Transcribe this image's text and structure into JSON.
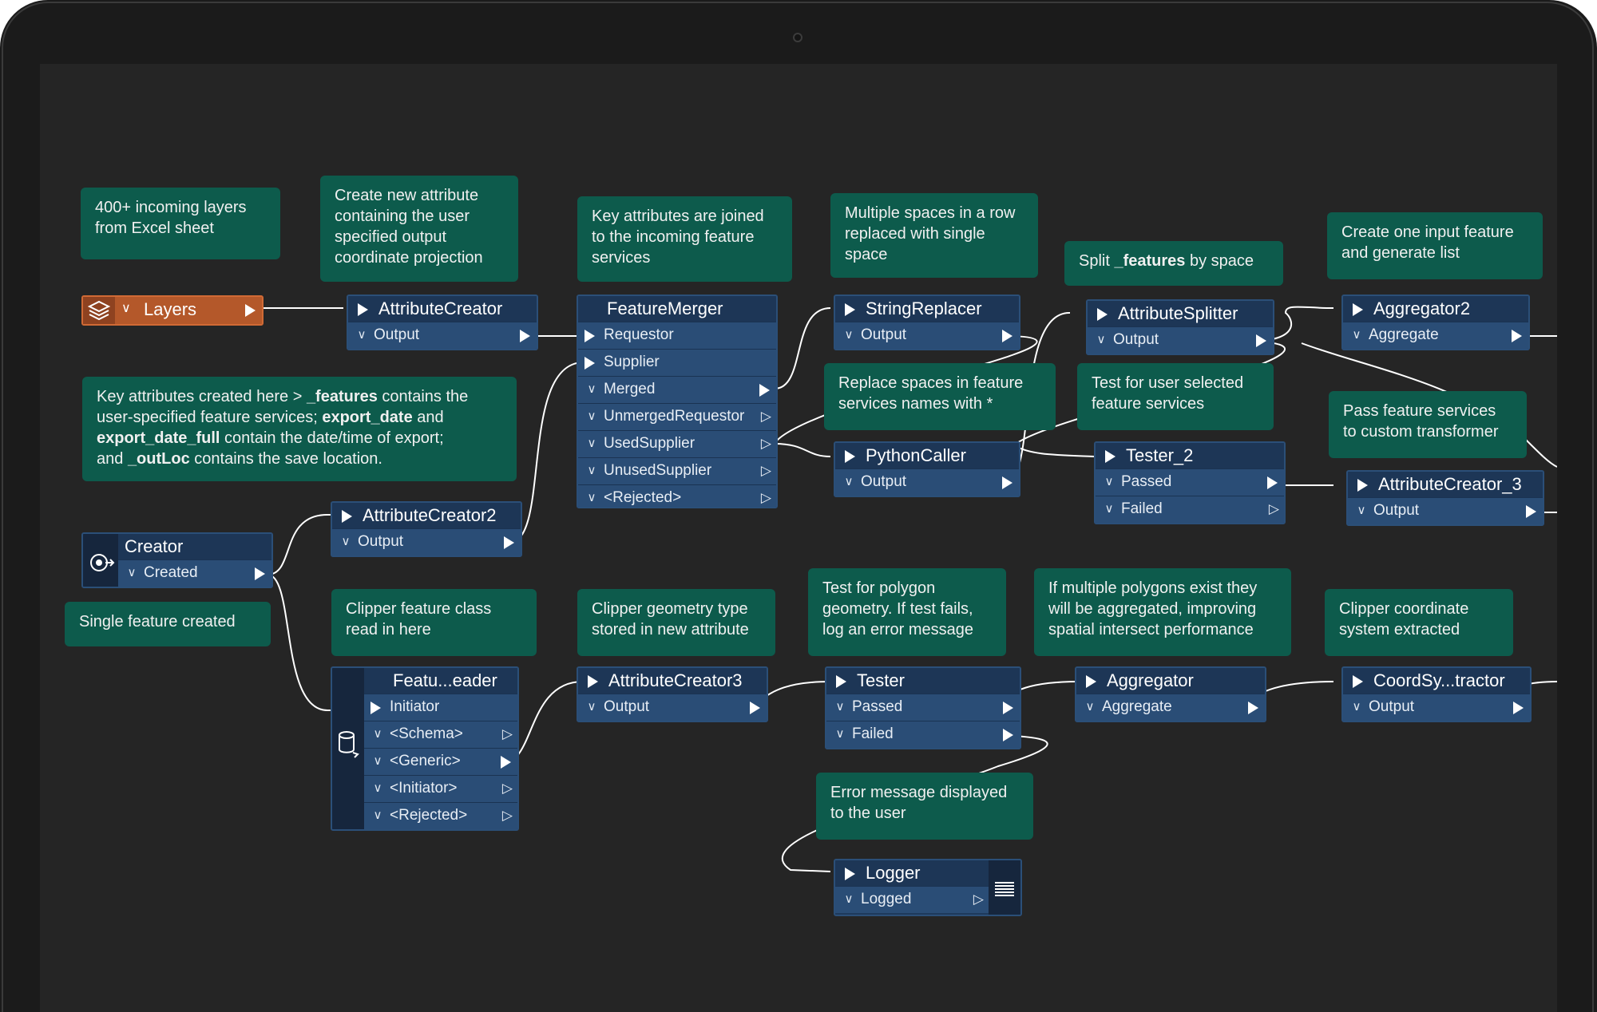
{
  "annotations": {
    "layers": "400+ incoming layers\nfrom Excel sheet",
    "create_attr": "Create new attribute\ncontaining the user\nspecified output\ncoordinate projection",
    "key_joined": "Key attributes are joined\nto the incoming feature\nservices",
    "multi_spaces": "Multiple spaces in a row\nreplaced with single\nspace",
    "split_pre": "Split ",
    "split_bold": "_features",
    "split_post": " by space",
    "create_one": "Create one input feature\nand generate list",
    "key_created_1": "Key attributes created here > ",
    "key_created_b1": "_features",
    "key_created_2": " contains the\nuser-specified feature services; ",
    "key_created_b2": "export_date",
    "key_created_3": " and\n",
    "key_created_b3": "export_date_full",
    "key_created_4": " contain the date/time of export;\nand ",
    "key_created_b4": "_outLoc",
    "key_created_5": " contains the save location.",
    "replace_spaces": "Replace spaces in feature\nservices names with *",
    "test_user": "Test for user selected\nfeature services",
    "pass_feature": "Pass feature services\nto custom transformer",
    "single_feature": "Single feature created",
    "clipper_class": "Clipper feature class\nread in here",
    "clipper_geom": "Clipper geometry type\nstored in new attribute",
    "test_polygon": "Test for polygon\ngeometry. If test fails,\nlog an error message",
    "multi_polygons": "If multiple polygons exist they\nwill be aggregated, improving\nspatial intersect performance",
    "clipper_coord": "Clipper coordinate\nsystem extracted",
    "error_msg": "Error message displayed\nto the user"
  },
  "nodes": {
    "layers": {
      "title": "Layers"
    },
    "attribute_creator": {
      "title": "AttributeCreator",
      "ports": [
        "Output"
      ]
    },
    "feature_merger": {
      "title": "FeatureMerger",
      "inputs": [
        "Requestor",
        "Supplier"
      ],
      "ports": [
        "Merged",
        "UnmergedRequestor",
        "UsedSupplier",
        "UnusedSupplier",
        "<Rejected>"
      ]
    },
    "string_replacer": {
      "title": "StringReplacer",
      "ports": [
        "Output"
      ]
    },
    "attribute_splitter": {
      "title": "AttributeSplitter",
      "ports": [
        "Output"
      ]
    },
    "aggregator2": {
      "title": "Aggregator2",
      "ports": [
        "Aggregate"
      ]
    },
    "python_caller": {
      "title": "PythonCaller",
      "ports": [
        "Output"
      ]
    },
    "tester_2": {
      "title": "Tester_2",
      "ports": [
        "Passed",
        "Failed"
      ]
    },
    "attribute_creator_3": {
      "title": "AttributeCreator_3",
      "ports": [
        "Output"
      ]
    },
    "attribute_creator2": {
      "title": "AttributeCreator2",
      "ports": [
        "Output"
      ]
    },
    "creator": {
      "title": "Creator",
      "ports": [
        "Created"
      ]
    },
    "feature_reader": {
      "title": "Featu...eader",
      "inputs": [
        "Initiator"
      ],
      "ports": [
        "<Schema>",
        "<Generic>",
        "<Initiator>",
        "<Rejected>"
      ]
    },
    "attribute_creator3": {
      "title": "AttributeCreator3",
      "ports": [
        "Output"
      ]
    },
    "tester": {
      "title": "Tester",
      "ports": [
        "Passed",
        "Failed"
      ]
    },
    "aggregator": {
      "title": "Aggregator",
      "ports": [
        "Aggregate"
      ]
    },
    "coord_extractor": {
      "title": "CoordSy...tractor",
      "ports": [
        "Output"
      ]
    },
    "logger": {
      "title": "Logger",
      "ports": [
        "Logged"
      ]
    }
  },
  "colors": {
    "annotation": "#0d5b4c",
    "node_body": "#2a4d76",
    "node_header": "#1d3656",
    "reader_node": "#b4582a",
    "canvas": "#252525"
  }
}
